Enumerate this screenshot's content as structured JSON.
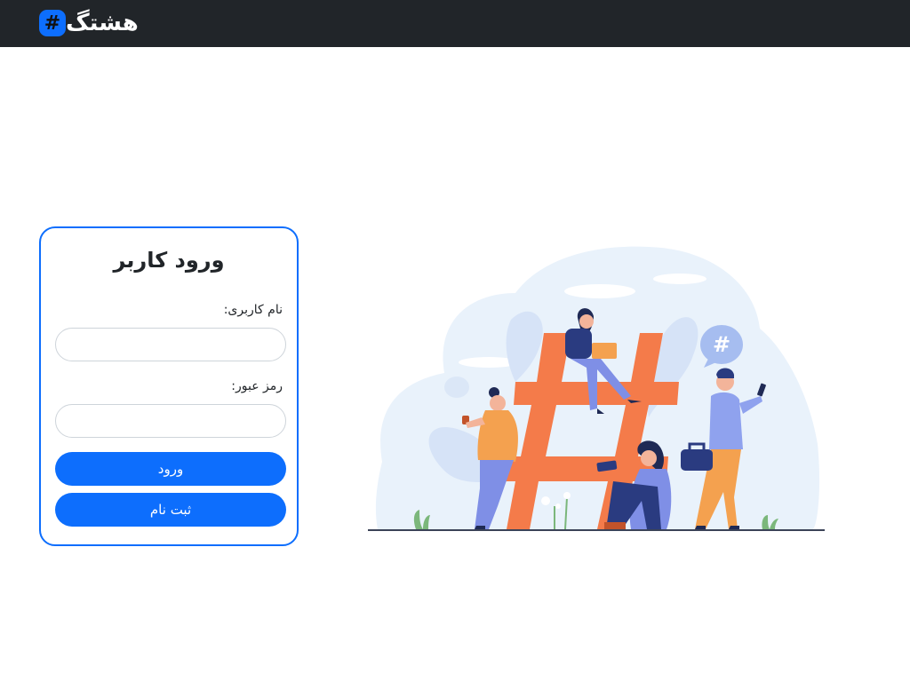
{
  "navbar": {
    "brand_symbol": "#",
    "brand_name": "هشتگ"
  },
  "login": {
    "title": "ورود کاربر",
    "username_label": "نام کاربری:",
    "username_value": "",
    "password_label": "رمز عبور:",
    "password_value": "",
    "login_button": "ورود",
    "register_button": "ثبت نام"
  },
  "illustration": {
    "bubble_symbol": "#"
  },
  "colors": {
    "navbar_bg": "#212529",
    "primary": "#0d6efd",
    "hashtag_orange": "#f47c4c",
    "blob_blue": "#e8f1fb"
  }
}
